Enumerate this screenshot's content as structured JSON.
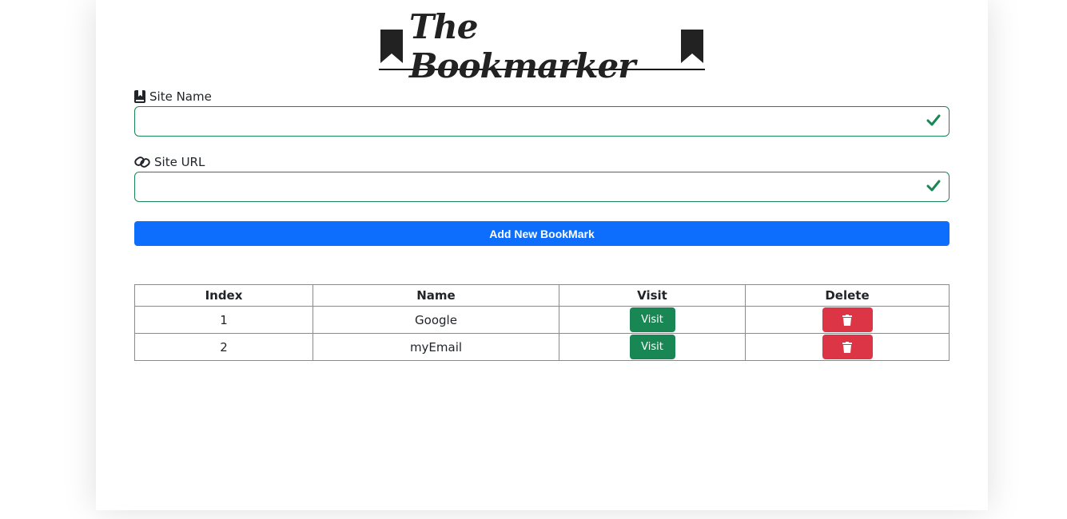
{
  "header": {
    "title": "The Bookmarker",
    "icon": "bookmark-icon"
  },
  "form": {
    "site_name": {
      "label": "Site Name",
      "icon": "book-bookmark-icon",
      "value": "",
      "status_icon": "check-icon"
    },
    "site_url": {
      "label": "Site URL",
      "icon": "link-icon",
      "value": "",
      "status_icon": "check-icon"
    },
    "submit_label": "Add New BookMark"
  },
  "table": {
    "columns": [
      "Index",
      "Name",
      "Visit",
      "Delete"
    ],
    "rows": [
      {
        "index": "1",
        "name": "Google",
        "visit_label": "Visit"
      },
      {
        "index": "2",
        "name": "myEmail",
        "visit_label": "Visit"
      }
    ]
  },
  "colors": {
    "primary": "#0d6efd",
    "success": "#198754",
    "danger": "#dc3545"
  }
}
